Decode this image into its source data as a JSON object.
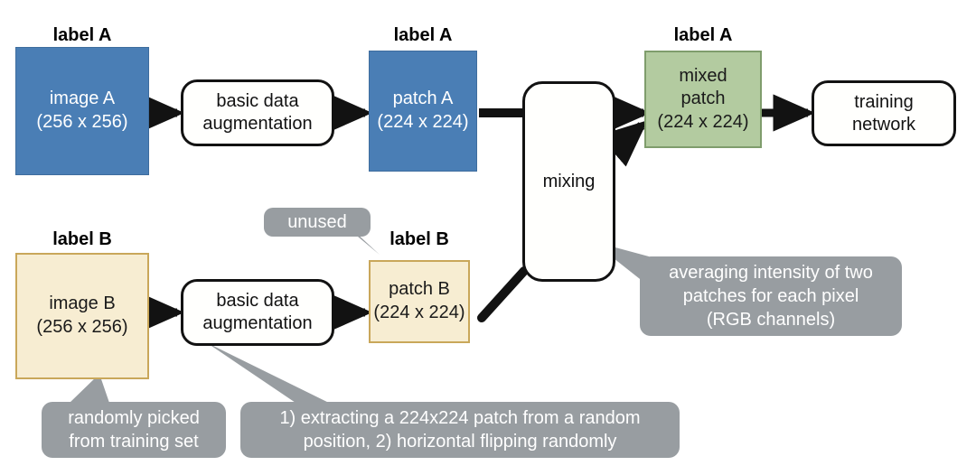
{
  "figure": {
    "title": "Mixup-style data augmentation pipeline",
    "colors": {
      "image_a_fill": "#4a7eb5",
      "image_b_fill": "#f7edd2",
      "image_b_border": "#c9a75a",
      "mixed_patch_fill": "#b3cba0",
      "mixed_patch_border": "#7f9d6c",
      "callout_fill": "#989da1",
      "stroke": "#121212",
      "background": "#ffffff"
    }
  },
  "labels": {
    "label_a_top_left": "label A",
    "label_a_patch": "label A",
    "label_a_mixed": "label A",
    "label_b_top_left": "label B",
    "label_b_patch": "label B"
  },
  "tiles": {
    "image_a": {
      "name": "image A",
      "size": "(256 x 256)"
    },
    "patch_a": {
      "name": "patch A",
      "size": "(224 x 224)"
    },
    "mixed_patch": {
      "name_line1": "mixed",
      "name_line2": "patch",
      "size": "(224 x 224)"
    },
    "image_b": {
      "name": "image B",
      "size": "(256 x 256)"
    },
    "patch_b": {
      "name": "patch B",
      "size": "(224 x 224)"
    }
  },
  "processes": {
    "aug_top": {
      "line1": "basic data",
      "line2": "augmentation"
    },
    "aug_bottom": {
      "line1": "basic data",
      "line2": "augmentation"
    },
    "mixing": {
      "line1": "mixing"
    },
    "training": {
      "line1": "training",
      "line2": "network"
    }
  },
  "callouts": {
    "unused": {
      "line1": "unused"
    },
    "averaging": {
      "line1": "averaging intensity of two",
      "line2": "patches for each pixel",
      "line3": "(RGB channels)"
    },
    "randomly_picked": {
      "line1": "randomly picked",
      "line2": "from training set"
    },
    "extracting": {
      "line1": "1) extracting a 224x224 patch from a random",
      "line2": "position, 2) horizontal flipping randomly"
    }
  }
}
